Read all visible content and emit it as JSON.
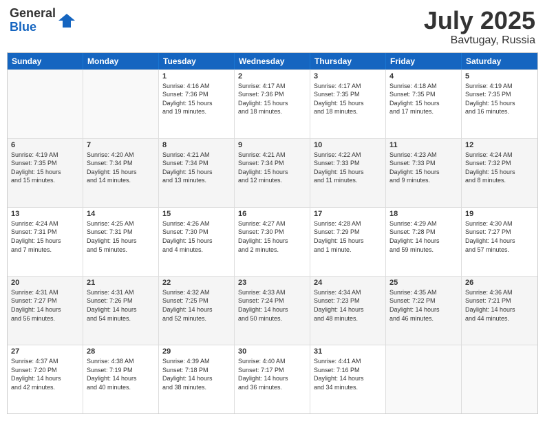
{
  "logo": {
    "general": "General",
    "blue": "Blue"
  },
  "title": "July 2025",
  "subtitle": "Bavtugay, Russia",
  "header_days": [
    "Sunday",
    "Monday",
    "Tuesday",
    "Wednesday",
    "Thursday",
    "Friday",
    "Saturday"
  ],
  "rows": [
    [
      {
        "day": "",
        "lines": []
      },
      {
        "day": "",
        "lines": []
      },
      {
        "day": "1",
        "lines": [
          "Sunrise: 4:16 AM",
          "Sunset: 7:36 PM",
          "Daylight: 15 hours",
          "and 19 minutes."
        ]
      },
      {
        "day": "2",
        "lines": [
          "Sunrise: 4:17 AM",
          "Sunset: 7:36 PM",
          "Daylight: 15 hours",
          "and 18 minutes."
        ]
      },
      {
        "day": "3",
        "lines": [
          "Sunrise: 4:17 AM",
          "Sunset: 7:35 PM",
          "Daylight: 15 hours",
          "and 18 minutes."
        ]
      },
      {
        "day": "4",
        "lines": [
          "Sunrise: 4:18 AM",
          "Sunset: 7:35 PM",
          "Daylight: 15 hours",
          "and 17 minutes."
        ]
      },
      {
        "day": "5",
        "lines": [
          "Sunrise: 4:19 AM",
          "Sunset: 7:35 PM",
          "Daylight: 15 hours",
          "and 16 minutes."
        ]
      }
    ],
    [
      {
        "day": "6",
        "lines": [
          "Sunrise: 4:19 AM",
          "Sunset: 7:35 PM",
          "Daylight: 15 hours",
          "and 15 minutes."
        ]
      },
      {
        "day": "7",
        "lines": [
          "Sunrise: 4:20 AM",
          "Sunset: 7:34 PM",
          "Daylight: 15 hours",
          "and 14 minutes."
        ]
      },
      {
        "day": "8",
        "lines": [
          "Sunrise: 4:21 AM",
          "Sunset: 7:34 PM",
          "Daylight: 15 hours",
          "and 13 minutes."
        ]
      },
      {
        "day": "9",
        "lines": [
          "Sunrise: 4:21 AM",
          "Sunset: 7:34 PM",
          "Daylight: 15 hours",
          "and 12 minutes."
        ]
      },
      {
        "day": "10",
        "lines": [
          "Sunrise: 4:22 AM",
          "Sunset: 7:33 PM",
          "Daylight: 15 hours",
          "and 11 minutes."
        ]
      },
      {
        "day": "11",
        "lines": [
          "Sunrise: 4:23 AM",
          "Sunset: 7:33 PM",
          "Daylight: 15 hours",
          "and 9 minutes."
        ]
      },
      {
        "day": "12",
        "lines": [
          "Sunrise: 4:24 AM",
          "Sunset: 7:32 PM",
          "Daylight: 15 hours",
          "and 8 minutes."
        ]
      }
    ],
    [
      {
        "day": "13",
        "lines": [
          "Sunrise: 4:24 AM",
          "Sunset: 7:31 PM",
          "Daylight: 15 hours",
          "and 7 minutes."
        ]
      },
      {
        "day": "14",
        "lines": [
          "Sunrise: 4:25 AM",
          "Sunset: 7:31 PM",
          "Daylight: 15 hours",
          "and 5 minutes."
        ]
      },
      {
        "day": "15",
        "lines": [
          "Sunrise: 4:26 AM",
          "Sunset: 7:30 PM",
          "Daylight: 15 hours",
          "and 4 minutes."
        ]
      },
      {
        "day": "16",
        "lines": [
          "Sunrise: 4:27 AM",
          "Sunset: 7:30 PM",
          "Daylight: 15 hours",
          "and 2 minutes."
        ]
      },
      {
        "day": "17",
        "lines": [
          "Sunrise: 4:28 AM",
          "Sunset: 7:29 PM",
          "Daylight: 15 hours",
          "and 1 minute."
        ]
      },
      {
        "day": "18",
        "lines": [
          "Sunrise: 4:29 AM",
          "Sunset: 7:28 PM",
          "Daylight: 14 hours",
          "and 59 minutes."
        ]
      },
      {
        "day": "19",
        "lines": [
          "Sunrise: 4:30 AM",
          "Sunset: 7:27 PM",
          "Daylight: 14 hours",
          "and 57 minutes."
        ]
      }
    ],
    [
      {
        "day": "20",
        "lines": [
          "Sunrise: 4:31 AM",
          "Sunset: 7:27 PM",
          "Daylight: 14 hours",
          "and 56 minutes."
        ]
      },
      {
        "day": "21",
        "lines": [
          "Sunrise: 4:31 AM",
          "Sunset: 7:26 PM",
          "Daylight: 14 hours",
          "and 54 minutes."
        ]
      },
      {
        "day": "22",
        "lines": [
          "Sunrise: 4:32 AM",
          "Sunset: 7:25 PM",
          "Daylight: 14 hours",
          "and 52 minutes."
        ]
      },
      {
        "day": "23",
        "lines": [
          "Sunrise: 4:33 AM",
          "Sunset: 7:24 PM",
          "Daylight: 14 hours",
          "and 50 minutes."
        ]
      },
      {
        "day": "24",
        "lines": [
          "Sunrise: 4:34 AM",
          "Sunset: 7:23 PM",
          "Daylight: 14 hours",
          "and 48 minutes."
        ]
      },
      {
        "day": "25",
        "lines": [
          "Sunrise: 4:35 AM",
          "Sunset: 7:22 PM",
          "Daylight: 14 hours",
          "and 46 minutes."
        ]
      },
      {
        "day": "26",
        "lines": [
          "Sunrise: 4:36 AM",
          "Sunset: 7:21 PM",
          "Daylight: 14 hours",
          "and 44 minutes."
        ]
      }
    ],
    [
      {
        "day": "27",
        "lines": [
          "Sunrise: 4:37 AM",
          "Sunset: 7:20 PM",
          "Daylight: 14 hours",
          "and 42 minutes."
        ]
      },
      {
        "day": "28",
        "lines": [
          "Sunrise: 4:38 AM",
          "Sunset: 7:19 PM",
          "Daylight: 14 hours",
          "and 40 minutes."
        ]
      },
      {
        "day": "29",
        "lines": [
          "Sunrise: 4:39 AM",
          "Sunset: 7:18 PM",
          "Daylight: 14 hours",
          "and 38 minutes."
        ]
      },
      {
        "day": "30",
        "lines": [
          "Sunrise: 4:40 AM",
          "Sunset: 7:17 PM",
          "Daylight: 14 hours",
          "and 36 minutes."
        ]
      },
      {
        "day": "31",
        "lines": [
          "Sunrise: 4:41 AM",
          "Sunset: 7:16 PM",
          "Daylight: 14 hours",
          "and 34 minutes."
        ]
      },
      {
        "day": "",
        "lines": []
      },
      {
        "day": "",
        "lines": []
      }
    ]
  ]
}
